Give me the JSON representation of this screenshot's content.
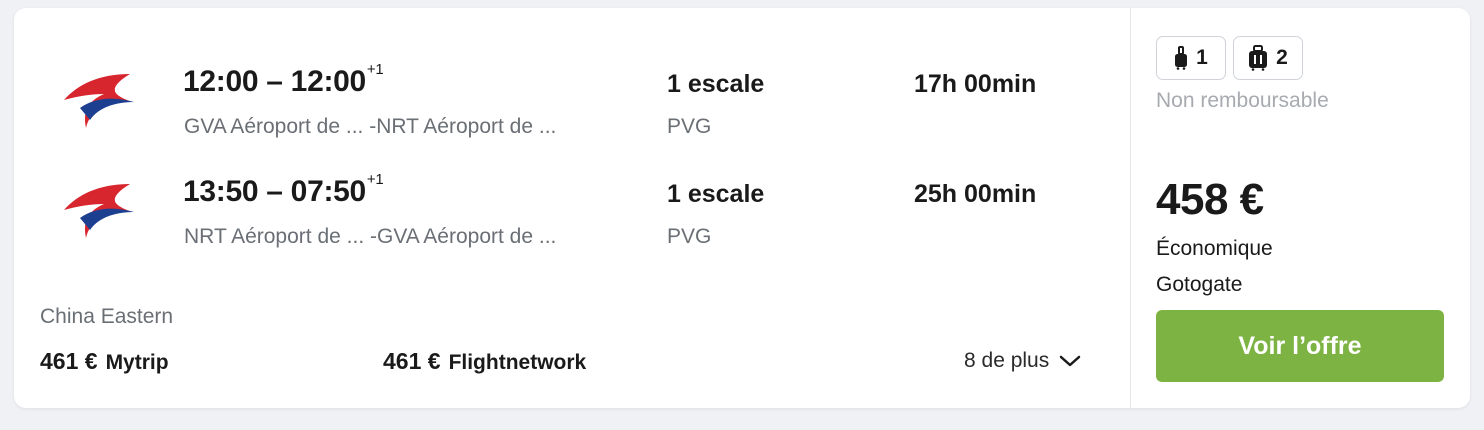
{
  "flights": [
    {
      "times": "12:00 – 12:00",
      "day_offset": "+1",
      "route": "GVA Aéroport de ... -NRT Aéroport de ...",
      "stops": "1 escale",
      "via": "PVG",
      "duration": "17h 00min"
    },
    {
      "times": "13:50 – 07:50",
      "day_offset": "+1",
      "route": "NRT Aéroport de ... -GVA Aéroport de ...",
      "stops": "1 escale",
      "via": "PVG",
      "duration": "25h 00min"
    }
  ],
  "airline": "China Eastern",
  "alternatives": [
    {
      "price": "461 €",
      "site": "Mytrip"
    },
    {
      "price": "461 €",
      "site": "Flightnetwork"
    }
  ],
  "more_label": "8 de plus",
  "baggage": {
    "cabin_count": "1",
    "checked_count": "2"
  },
  "refund_label": "Non remboursable",
  "price": "458 €",
  "cabin_class": "Économique",
  "provider": "Gotogate",
  "cta_label": "Voir l’offre",
  "colors": {
    "cta": "#7cb342",
    "logo_red": "#d8262f",
    "logo_blue": "#1d3f8f"
  }
}
